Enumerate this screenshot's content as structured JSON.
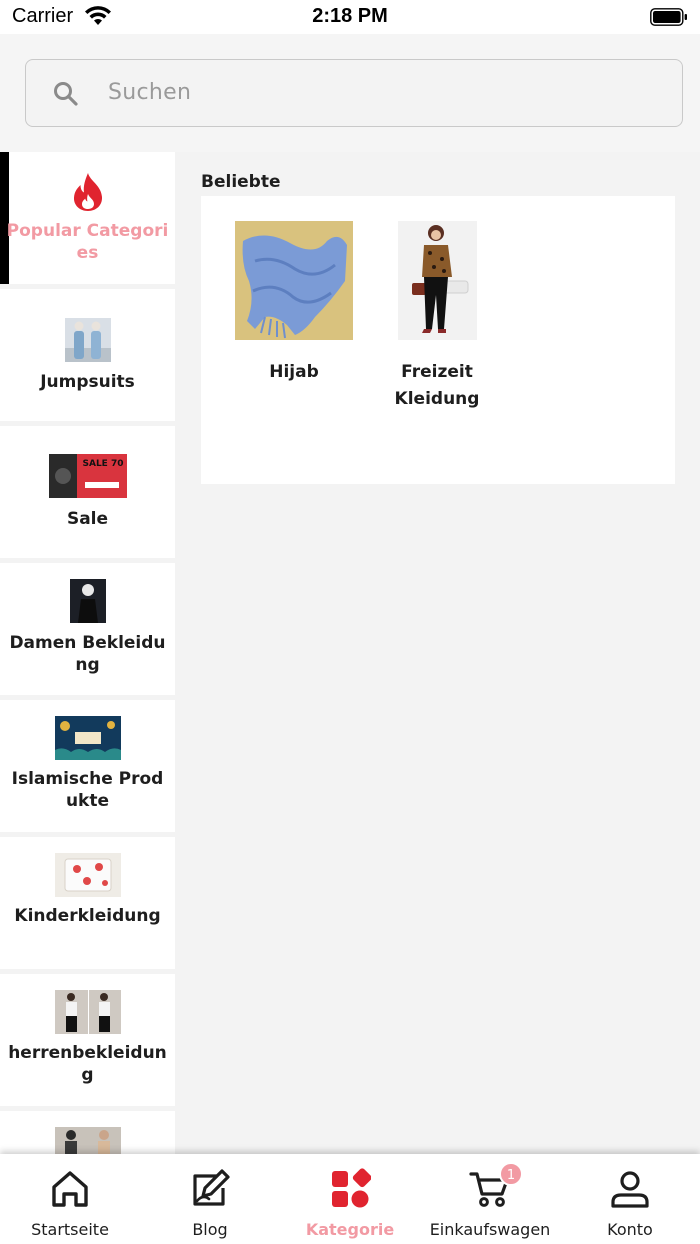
{
  "status_bar": {
    "carrier": "Carrier",
    "time": "2:18 PM"
  },
  "search": {
    "placeholder": "Suchen",
    "icon": "search-icon"
  },
  "sidebar": {
    "items": [
      {
        "label": "Popular Categories",
        "icon": "flame-icon",
        "active": true
      },
      {
        "label": "Jumpsuits"
      },
      {
        "label": "Sale",
        "thumb_text": "SALE 70"
      },
      {
        "label": "Damen Bekleidung"
      },
      {
        "label": "Islamische Produkte"
      },
      {
        "label": "Kinderkleidung"
      },
      {
        "label": "herrenbekleidung"
      },
      {
        "label": ""
      }
    ]
  },
  "main": {
    "section_title": "Beliebte",
    "products": [
      {
        "label": "Hijab"
      },
      {
        "label": "Freizeit Kleidung"
      }
    ]
  },
  "bottom_nav": {
    "items": [
      {
        "label": "Startseite",
        "icon": "home-icon"
      },
      {
        "label": "Blog",
        "icon": "edit-icon"
      },
      {
        "label": "Kategorie",
        "icon": "category-icon",
        "active": true
      },
      {
        "label": "Einkaufswagen",
        "icon": "cart-icon",
        "badge": "1"
      },
      {
        "label": "Konto",
        "icon": "account-icon"
      }
    ]
  },
  "colors": {
    "accent": "#f29aa3",
    "flame": "#e0242f",
    "active_bar": "#000000"
  }
}
